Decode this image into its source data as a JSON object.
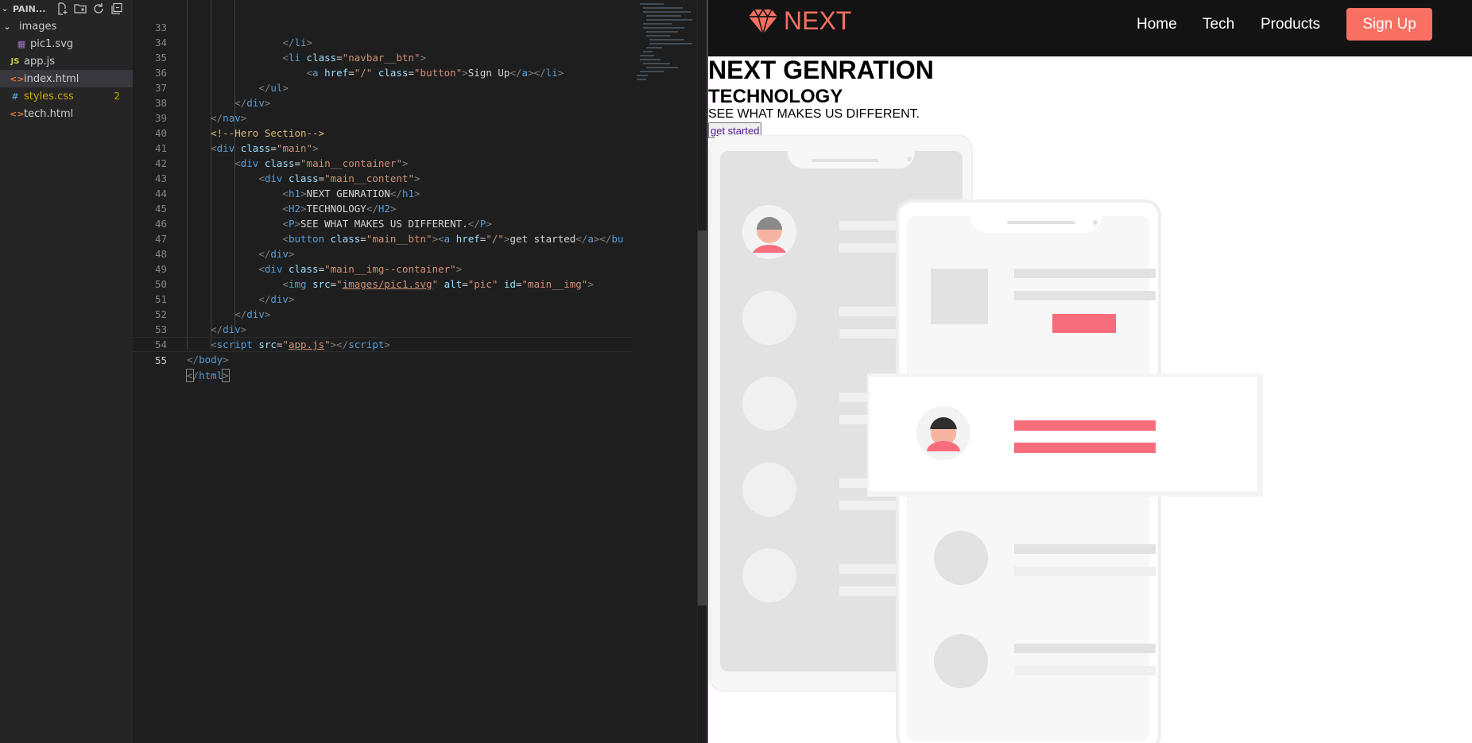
{
  "explorer": {
    "title": "PAIN...",
    "items": [
      {
        "label": "images",
        "kind": "folder"
      },
      {
        "label": "pic1.svg",
        "kind": "svg"
      },
      {
        "label": "app.js",
        "kind": "js",
        "icon": "JS"
      },
      {
        "label": "index.html",
        "kind": "html",
        "icon": "<>"
      },
      {
        "label": "styles.css",
        "kind": "css",
        "icon": "#",
        "badge": "2"
      },
      {
        "label": "tech.html",
        "kind": "html",
        "icon": "<>"
      }
    ]
  },
  "editor": {
    "line_numbers": [
      "33",
      "34",
      "35",
      "36",
      "37",
      "38",
      "39",
      "40",
      "41",
      "42",
      "43",
      "44",
      "45",
      "46",
      "47",
      "48",
      "49",
      "50",
      "51",
      "52",
      "53",
      "54",
      "55"
    ],
    "current_line": "55",
    "code": {
      "l33_tag": "li",
      "l34_tag": "li",
      "l34_attr": "class",
      "l34_val": "\"navbar__btn\"",
      "l35_tag": "a",
      "l35_attr1": "href",
      "l35_val1": "\"/\"",
      "l35_attr2": "class",
      "l35_val2": "\"button\"",
      "l35_text": "Sign Up",
      "l35_close1": "a",
      "l35_close2": "li",
      "l36_tag": "ul",
      "l37_tag": "div",
      "l38_tag": "nav",
      "l39_comment": "<!--Hero Section-->",
      "l40_tag": "div",
      "l40_attr": "class",
      "l40_val": "\"main\"",
      "l41_tag": "div",
      "l41_attr": "class",
      "l41_val": "\"main__container\"",
      "l42_tag": "div",
      "l42_attr": "class",
      "l42_val": "\"main__content\"",
      "l43_tag": "h1",
      "l43_text": "NEXT GENRATION",
      "l44_tag": "H2",
      "l44_text": "TECHNOLOGY",
      "l45_tag": "P",
      "l45_text": "SEE WHAT MAKES US DIFFERENT.",
      "l46_tag": "button",
      "l46_attr": "class",
      "l46_val": "\"main__btn\"",
      "l46_tag2": "a",
      "l46_attr2": "href",
      "l46_val2": "\"/\"",
      "l46_text": "get started",
      "l46_close1": "a",
      "l46_close2": "bu",
      "l47_tag": "div",
      "l48_tag": "div",
      "l48_attr": "class",
      "l48_val": "\"main__img--container\"",
      "l49_tag": "img",
      "l49_attr1": "src",
      "l49_val1a": "\"",
      "l49_val1b": "images/pic1.svg",
      "l49_val1c": "\"",
      "l49_attr2": "alt",
      "l49_val2": "\"pic\"",
      "l49_attr3": "id",
      "l49_val3": "\"main__img\"",
      "l50_tag": "div",
      "l51_tag": "div",
      "l52_tag": "div",
      "l53_tag": "script",
      "l53_attr": "src",
      "l53_val_a": "\"",
      "l53_val_b": "app.js",
      "l53_val_c": "\"",
      "l53_close": "script",
      "l54_tag": "body",
      "l55_tag": "html"
    }
  },
  "preview": {
    "logo_text": "NEXT",
    "nav": {
      "home": "Home",
      "tech": "Tech",
      "products": "Products",
      "signup": "Sign Up"
    },
    "hero": {
      "h1": "NEXT GENRATION",
      "h2": "TECHNOLOGY",
      "p": "SEE WHAT MAKES US DIFFERENT.",
      "button": "get started"
    }
  },
  "colors": {
    "accent": "#f77062",
    "navbar_bg": "#131313",
    "editor_bg": "#1e1e1e"
  }
}
